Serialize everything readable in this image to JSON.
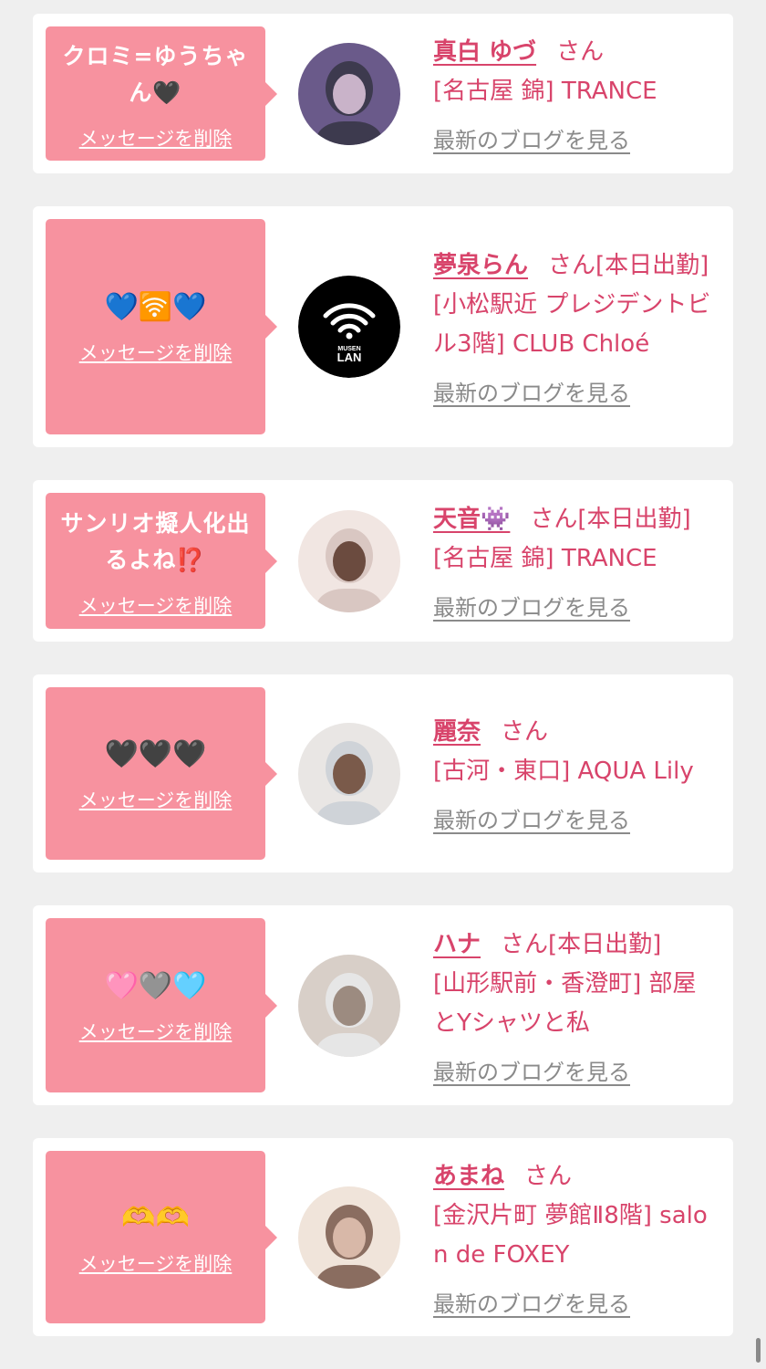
{
  "cards": [
    {
      "message": "クロミ=ゆうちゃん🖤",
      "delete_label": "メッセージを削除",
      "name": "真白 ゆづ",
      "san": "さん",
      "badge": "",
      "store": "[名古屋 錦] TRANCE",
      "blog_label": "最新のブログを見る",
      "avatar": "photo-icon"
    },
    {
      "message": "💙🛜💙",
      "delete_label": "メッセージを削除",
      "name": "夢泉らん",
      "san": "さん",
      "badge": "[本日出勤]",
      "store": "[小松駅近 プレジデントビル3階] CLUB Chloé",
      "blog_label": "最新のブログを見る",
      "avatar": "wifi-icon",
      "avatar_text": "MUSEN\nLAN"
    },
    {
      "message": "サンリオ擬人化出るよね⁉️",
      "delete_label": "メッセージを削除",
      "name": "天音👾",
      "san": "さん",
      "badge": "[本日出勤]",
      "store": "[名古屋 錦] TRANCE",
      "blog_label": "最新のブログを見る",
      "avatar": "photo-icon"
    },
    {
      "message": "🖤🖤🖤",
      "delete_label": "メッセージを削除",
      "name": "麗奈",
      "san": "さん",
      "badge": "",
      "store": "[古河・東口] AQUA Lily",
      "blog_label": "最新のブログを見る",
      "avatar": "photo-icon"
    },
    {
      "message": "🩷🩶🩵",
      "delete_label": "メッセージを削除",
      "name": "ハナ",
      "san": "さん",
      "badge": "[本日出勤]",
      "store": "[山形駅前・香澄町] 部屋とYシャツと私",
      "blog_label": "最新のブログを見る",
      "avatar": "photo-icon"
    },
    {
      "message": "🫶🫶",
      "delete_label": "メッセージを削除",
      "name": "あまね",
      "san": "さん",
      "badge": "",
      "store": "[金沢片町 夢館Ⅱ8階] salon de FOXEY",
      "blog_label": "最新のブログを見る",
      "avatar": "photo-icon"
    }
  ],
  "colors": {
    "accent": "#d8446b",
    "bubble": "#f7929f",
    "background": "#efefef",
    "link_gray": "#8a8a8a"
  }
}
